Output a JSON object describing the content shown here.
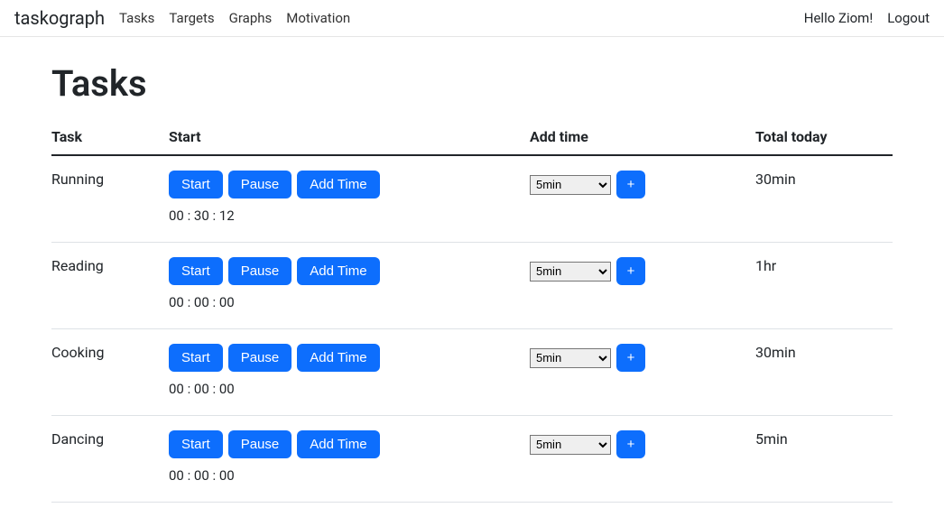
{
  "nav": {
    "brand": "taskograph",
    "links": [
      "Tasks",
      "Targets",
      "Graphs",
      "Motivation"
    ],
    "greeting": "Hello Ziom!",
    "logout": "Logout"
  },
  "page": {
    "title": "Tasks"
  },
  "columns": {
    "task": "Task",
    "start": "Start",
    "addtime": "Add time",
    "total": "Total today"
  },
  "buttons": {
    "start": "Start",
    "pause": "Pause",
    "addtime": "Add Time",
    "plus": "+"
  },
  "select": {
    "value": "5min"
  },
  "tasks": [
    {
      "name": "Running",
      "timer": "00 : 30 : 12",
      "total": "30min"
    },
    {
      "name": "Reading",
      "timer": "00 : 00 : 00",
      "total": "1hr"
    },
    {
      "name": "Cooking",
      "timer": "00 : 00 : 00",
      "total": "30min"
    },
    {
      "name": "Dancing",
      "timer": "00 : 00 : 00",
      "total": "5min"
    }
  ]
}
